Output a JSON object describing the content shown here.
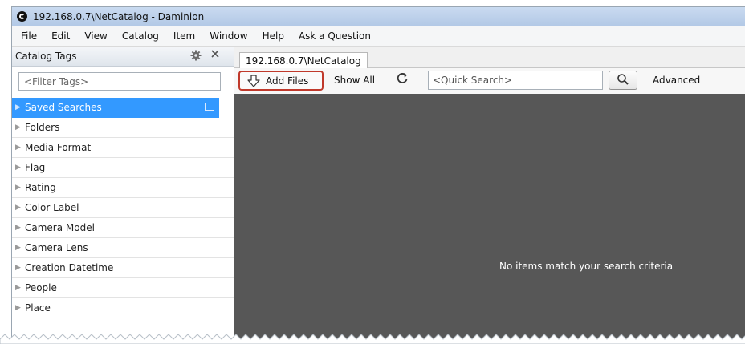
{
  "window": {
    "title": "192.168.0.7\\NetCatalog - Daminion"
  },
  "menu": [
    "File",
    "Edit",
    "View",
    "Catalog",
    "Item",
    "Window",
    "Help",
    "Ask a Question"
  ],
  "left_panel": {
    "title": "Catalog Tags",
    "filter_placeholder": "<Filter Tags>",
    "tags": [
      "Saved Searches",
      "Folders",
      "Media Format",
      "Flag",
      "Rating",
      "Color Label",
      "Camera Model",
      "Camera Lens",
      "Creation Datetime",
      "People",
      "Place"
    ],
    "selected_index": 0
  },
  "tab": {
    "label": "192.168.0.7\\NetCatalog"
  },
  "toolbar": {
    "add_files": "Add Files",
    "show_all": "Show All",
    "quick_search_placeholder": "<Quick Search>",
    "advanced": "Advanced"
  },
  "content": {
    "empty_message": "No items match your search criteria"
  },
  "colors": {
    "selection": "#3399ff",
    "highlight_border": "#c0392b",
    "content_bg": "#575757"
  },
  "icons": [
    "app-logo-icon",
    "gear-icon",
    "close-icon",
    "expand-arrow-icon",
    "add-files-icon",
    "refresh-icon",
    "magnifier-icon"
  ]
}
